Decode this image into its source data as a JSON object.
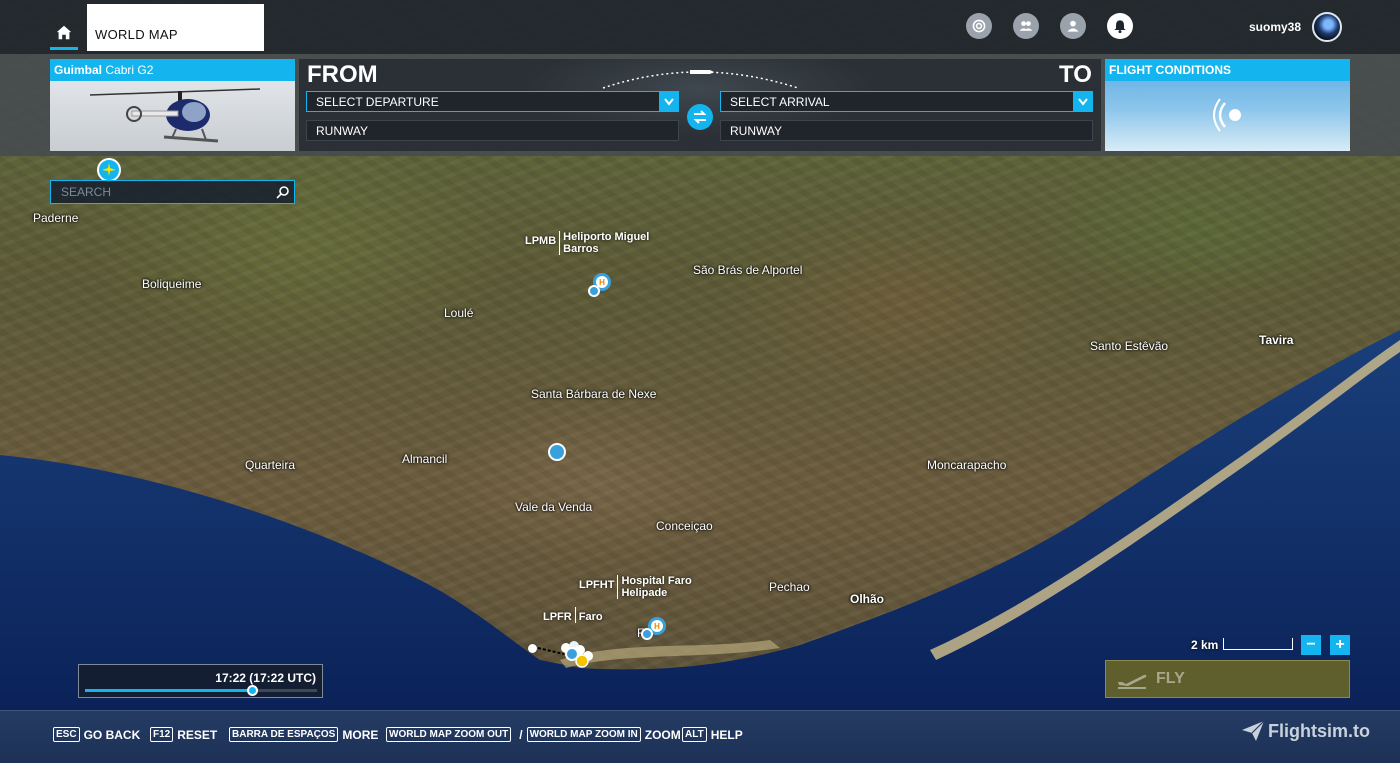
{
  "topbar": {
    "tab_label": "WORLD MAP",
    "username": "suomy38",
    "icons": [
      "home-icon",
      "activity-icon",
      "friends-icon",
      "profile-icon",
      "notifications-icon"
    ]
  },
  "aircraft": {
    "brand": "Guimbal",
    "model": "Cabri G2"
  },
  "route": {
    "from_title": "FROM",
    "to_title": "TO",
    "departure_select": "SELECT DEPARTURE",
    "arrival_select": "SELECT ARRIVAL",
    "departure_runway": "RUNWAY",
    "arrival_runway": "RUNWAY"
  },
  "conditions": {
    "title": "FLIGHT CONDITIONS"
  },
  "search": {
    "placeholder": "SEARCH"
  },
  "map": {
    "towns": [
      "Paderne",
      "Boliqueime",
      "Loulé",
      "São Brás de Alportel",
      "Santo Estêvão",
      "Tavira",
      "Santa Bárbara de Nexe",
      "Quarteira",
      "Almancil",
      "Moncarapacho",
      "Vale da Venda",
      "Conceiçao",
      "Pechao",
      "Olhão",
      "Fa"
    ],
    "airports": [
      {
        "code": "LPMB",
        "name_line1": "Heliporto Miguel",
        "name_line2": "Barros"
      },
      {
        "code": "LPFHT",
        "name_line1": "Hospital Faro",
        "name_line2": "Helipade"
      },
      {
        "code": "LPFR",
        "name_line1": "Faro",
        "name_line2": ""
      }
    ]
  },
  "time": {
    "label": "17:22 (17:22 UTC)",
    "progress": 0.72
  },
  "scale": {
    "label": "2 km"
  },
  "zoom": {
    "minus": "−",
    "plus": "+"
  },
  "fly": {
    "label": "FLY"
  },
  "hints": {
    "esc_key": "ESC",
    "esc_label": "GO BACK",
    "f12_key": "F12",
    "f12_label": "RESET",
    "space_key": "BARRA DE ESPAÇOS",
    "space_label": "MORE",
    "zoom_out_key": "WORLD MAP ZOOM OUT",
    "slash": "/",
    "zoom_in_key": "WORLD MAP ZOOM IN",
    "zoom_label": "ZOOM",
    "alt_key": "ALT",
    "alt_label": "HELP"
  },
  "brand": {
    "label": "Flightsim.to"
  },
  "colors": {
    "accent": "#14b5ee",
    "sea": "#0e2a6a",
    "bottom_bar": "#243b63"
  }
}
